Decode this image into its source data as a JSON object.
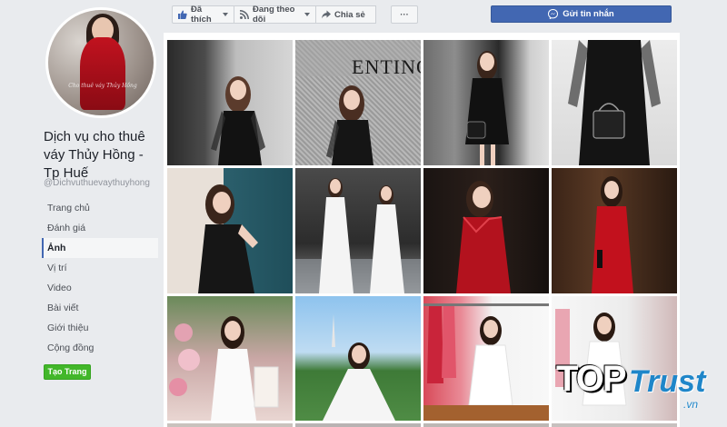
{
  "sidebar": {
    "page_name": "Dịch vụ cho thuê váy Thủy Hồng - Tp Huế",
    "handle": "@Dichvuthuevaythuyhong",
    "avatar_caption": "Cho thuê váy Thủy Hồng",
    "nav": [
      {
        "label": "Trang chủ",
        "active": false
      },
      {
        "label": "Đánh giá",
        "active": false
      },
      {
        "label": "Ảnh",
        "active": true
      },
      {
        "label": "Vị trí",
        "active": false
      },
      {
        "label": "Video",
        "active": false
      },
      {
        "label": "Bài viết",
        "active": false
      },
      {
        "label": "Giới thiệu",
        "active": false
      },
      {
        "label": "Cộng đồng",
        "active": false
      }
    ],
    "create_page_label": "Tạo Trang"
  },
  "actionbar": {
    "like_label": "Đã thích",
    "follow_label": "Đang theo dõi",
    "share_label": "Chia sẻ",
    "more_label": "···",
    "message_label": "Gửi tin nhắn"
  },
  "photos": [
    {
      "id": "p1",
      "scene": "black-dress-sheer-sleeves"
    },
    {
      "id": "p2",
      "scene": "valentino-wall-black-dress"
    },
    {
      "id": "p3",
      "scene": "black-dress-handbag"
    },
    {
      "id": "p4",
      "scene": "black-dress-lady-dior-bag"
    },
    {
      "id": "p5",
      "scene": "black-satin-teal-wall"
    },
    {
      "id": "p6",
      "scene": "white-gown-dining-room"
    },
    {
      "id": "p7",
      "scene": "red-satin-dark-room"
    },
    {
      "id": "p8",
      "scene": "red-satin-wood-room"
    },
    {
      "id": "p9",
      "scene": "white-dress-flowers"
    },
    {
      "id": "p10",
      "scene": "white-gown-garden"
    },
    {
      "id": "p11",
      "scene": "white-dress-rack"
    },
    {
      "id": "p12",
      "scene": "white-dress-shop"
    }
  ],
  "watermark": {
    "top": "TOP",
    "trust": "Trust",
    "vn": ".vn"
  },
  "colors": {
    "brand": "#4267b2",
    "create_button": "#42b72a",
    "background": "#e9ebee",
    "watermark_blue": "#1f86c9"
  }
}
